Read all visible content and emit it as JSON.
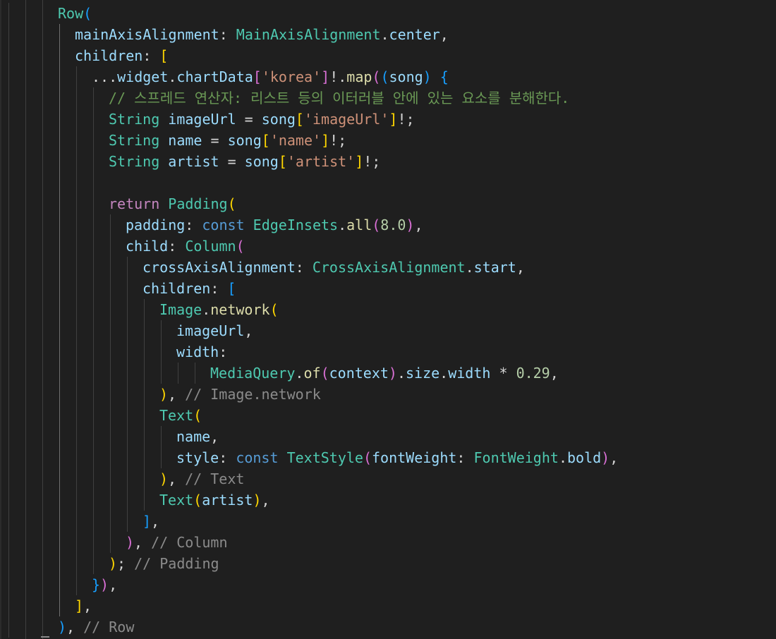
{
  "editor": {
    "language": "dart",
    "colors": {
      "background": "#1f1f1f",
      "type": "#4ec9b0",
      "property": "#9cdcfe",
      "function": "#dcdcaa",
      "keyword": "#569cd6",
      "control": "#c586c0",
      "string": "#ce9178",
      "number": "#b5cea8",
      "comment": "#6a9955",
      "inline_hint": "#8b8b8b",
      "bracket_gold": "#ffd700",
      "bracket_orchid": "#da70d6",
      "bracket_blue": "#179fff"
    },
    "lines": [
      {
        "indent": 3,
        "tokens": [
          [
            "Row",
            "type"
          ],
          [
            "(",
            "b3"
          ]
        ]
      },
      {
        "indent": 4,
        "tokens": [
          [
            "mainAxisAlignment",
            "prop"
          ],
          [
            ": ",
            "punc"
          ],
          [
            "MainAxisAlignment",
            "type"
          ],
          [
            ".",
            "punc"
          ],
          [
            "center",
            "prop"
          ],
          [
            ",",
            "punc"
          ]
        ]
      },
      {
        "indent": 4,
        "tokens": [
          [
            "children",
            "prop"
          ],
          [
            ": ",
            "punc"
          ],
          [
            "[",
            "b1"
          ]
        ]
      },
      {
        "indent": 5,
        "tokens": [
          [
            "...",
            "punc"
          ],
          [
            "widget",
            "var"
          ],
          [
            ".",
            "punc"
          ],
          [
            "chartData",
            "prop"
          ],
          [
            "[",
            "b2"
          ],
          [
            "'korea'",
            "str"
          ],
          [
            "]",
            "b2"
          ],
          [
            "!.",
            "punc"
          ],
          [
            "map",
            "fn"
          ],
          [
            "(",
            "b2"
          ],
          [
            "(",
            "b3"
          ],
          [
            "song",
            "var"
          ],
          [
            ")",
            "b3"
          ],
          [
            " ",
            "punc"
          ],
          [
            "{",
            "b3"
          ]
        ]
      },
      {
        "indent": 6,
        "tokens": [
          [
            "// 스프레드 연산자: 리스트 등의 이터러블 안에 있는 요소를 분해한다.",
            "cm"
          ]
        ]
      },
      {
        "indent": 6,
        "tokens": [
          [
            "String",
            "type"
          ],
          [
            " ",
            "punc"
          ],
          [
            "imageUrl",
            "var"
          ],
          [
            " = ",
            "punc"
          ],
          [
            "song",
            "var"
          ],
          [
            "[",
            "b1"
          ],
          [
            "'imageUrl'",
            "str"
          ],
          [
            "]",
            "b1"
          ],
          [
            "!;",
            "punc"
          ]
        ]
      },
      {
        "indent": 6,
        "tokens": [
          [
            "String",
            "type"
          ],
          [
            " ",
            "punc"
          ],
          [
            "name",
            "var"
          ],
          [
            " = ",
            "punc"
          ],
          [
            "song",
            "var"
          ],
          [
            "[",
            "b1"
          ],
          [
            "'name'",
            "str"
          ],
          [
            "]",
            "b1"
          ],
          [
            "!;",
            "punc"
          ]
        ]
      },
      {
        "indent": 6,
        "tokens": [
          [
            "String",
            "type"
          ],
          [
            " ",
            "punc"
          ],
          [
            "artist",
            "var"
          ],
          [
            " = ",
            "punc"
          ],
          [
            "song",
            "var"
          ],
          [
            "[",
            "b1"
          ],
          [
            "'artist'",
            "str"
          ],
          [
            "]",
            "b1"
          ],
          [
            "!;",
            "punc"
          ]
        ]
      },
      {
        "indent": 6,
        "tokens": []
      },
      {
        "indent": 6,
        "tokens": [
          [
            "return",
            "ctrl"
          ],
          [
            " ",
            "punc"
          ],
          [
            "Padding",
            "type"
          ],
          [
            "(",
            "b1"
          ]
        ]
      },
      {
        "indent": 7,
        "tokens": [
          [
            "padding",
            "prop"
          ],
          [
            ": ",
            "punc"
          ],
          [
            "const",
            "kw"
          ],
          [
            " ",
            "punc"
          ],
          [
            "EdgeInsets",
            "type"
          ],
          [
            ".",
            "punc"
          ],
          [
            "all",
            "fn"
          ],
          [
            "(",
            "b2"
          ],
          [
            "8.0",
            "num"
          ],
          [
            ")",
            "b2"
          ],
          [
            ",",
            "punc"
          ]
        ]
      },
      {
        "indent": 7,
        "tokens": [
          [
            "child",
            "prop"
          ],
          [
            ": ",
            "punc"
          ],
          [
            "Column",
            "type"
          ],
          [
            "(",
            "b2"
          ]
        ]
      },
      {
        "indent": 8,
        "tokens": [
          [
            "crossAxisAlignment",
            "prop"
          ],
          [
            ": ",
            "punc"
          ],
          [
            "CrossAxisAlignment",
            "type"
          ],
          [
            ".",
            "punc"
          ],
          [
            "start",
            "prop"
          ],
          [
            ",",
            "punc"
          ]
        ]
      },
      {
        "indent": 8,
        "tokens": [
          [
            "children",
            "prop"
          ],
          [
            ": ",
            "punc"
          ],
          [
            "[",
            "b3"
          ]
        ]
      },
      {
        "indent": 9,
        "tokens": [
          [
            "Image",
            "type"
          ],
          [
            ".",
            "punc"
          ],
          [
            "network",
            "fn"
          ],
          [
            "(",
            "b1"
          ]
        ]
      },
      {
        "indent": 10,
        "tokens": [
          [
            "imageUrl",
            "var"
          ],
          [
            ",",
            "punc"
          ]
        ]
      },
      {
        "indent": 10,
        "tokens": [
          [
            "width",
            "prop"
          ],
          [
            ":",
            "punc"
          ]
        ]
      },
      {
        "indent": 12,
        "tokens": [
          [
            "MediaQuery",
            "type"
          ],
          [
            ".",
            "punc"
          ],
          [
            "of",
            "fn"
          ],
          [
            "(",
            "b2"
          ],
          [
            "context",
            "var"
          ],
          [
            ")",
            "b2"
          ],
          [
            ".",
            "punc"
          ],
          [
            "size",
            "prop"
          ],
          [
            ".",
            "punc"
          ],
          [
            "width",
            "prop"
          ],
          [
            " * ",
            "punc"
          ],
          [
            "0.29",
            "num"
          ],
          [
            ",",
            "punc"
          ]
        ]
      },
      {
        "indent": 9,
        "tokens": [
          [
            ")",
            "b1"
          ],
          [
            ", ",
            "punc"
          ],
          [
            "// Image.network",
            "cmg"
          ]
        ]
      },
      {
        "indent": 9,
        "tokens": [
          [
            "Text",
            "type"
          ],
          [
            "(",
            "b1"
          ]
        ]
      },
      {
        "indent": 10,
        "tokens": [
          [
            "name",
            "var"
          ],
          [
            ",",
            "punc"
          ]
        ]
      },
      {
        "indent": 10,
        "tokens": [
          [
            "style",
            "prop"
          ],
          [
            ": ",
            "punc"
          ],
          [
            "const",
            "kw"
          ],
          [
            " ",
            "punc"
          ],
          [
            "TextStyle",
            "type"
          ],
          [
            "(",
            "b2"
          ],
          [
            "fontWeight",
            "prop"
          ],
          [
            ": ",
            "punc"
          ],
          [
            "FontWeight",
            "type"
          ],
          [
            ".",
            "punc"
          ],
          [
            "bold",
            "prop"
          ],
          [
            ")",
            "b2"
          ],
          [
            ",",
            "punc"
          ]
        ]
      },
      {
        "indent": 9,
        "tokens": [
          [
            ")",
            "b1"
          ],
          [
            ", ",
            "punc"
          ],
          [
            "// Text",
            "cmg"
          ]
        ]
      },
      {
        "indent": 9,
        "tokens": [
          [
            "Text",
            "type"
          ],
          [
            "(",
            "b1"
          ],
          [
            "artist",
            "var"
          ],
          [
            ")",
            "b1"
          ],
          [
            ",",
            "punc"
          ]
        ]
      },
      {
        "indent": 8,
        "tokens": [
          [
            "]",
            "b3"
          ],
          [
            ",",
            "punc"
          ]
        ]
      },
      {
        "indent": 7,
        "tokens": [
          [
            ")",
            "b2"
          ],
          [
            ", ",
            "punc"
          ],
          [
            "// Column",
            "cmg"
          ]
        ]
      },
      {
        "indent": 6,
        "tokens": [
          [
            ")",
            "b1"
          ],
          [
            "; ",
            "punc"
          ],
          [
            "// Padding",
            "cmg"
          ]
        ]
      },
      {
        "indent": 5,
        "tokens": [
          [
            "}",
            "b3"
          ],
          [
            ")",
            "b2"
          ],
          [
            ",",
            "punc"
          ]
        ]
      },
      {
        "indent": 4,
        "tokens": [
          [
            "]",
            "b1"
          ],
          [
            ",",
            "punc"
          ]
        ]
      },
      {
        "indent": 3,
        "tokens": [
          [
            ")",
            "b3"
          ],
          [
            ", ",
            "punc"
          ],
          [
            "// Row",
            "cmg"
          ]
        ]
      }
    ]
  }
}
